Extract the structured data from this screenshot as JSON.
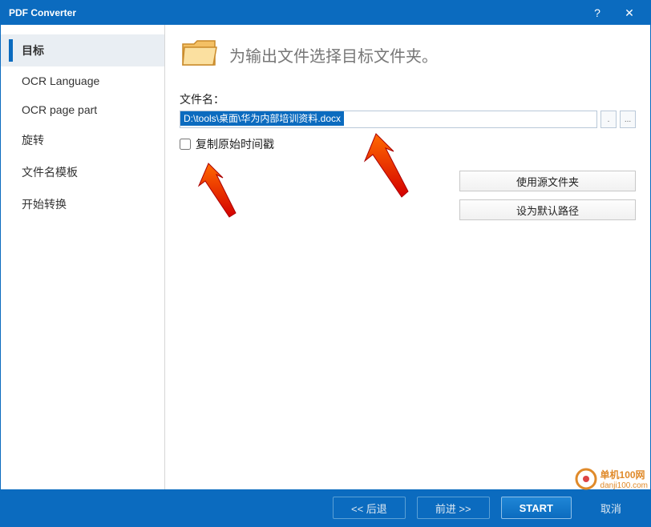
{
  "window": {
    "title": "PDF Converter"
  },
  "sidebar": {
    "items": [
      {
        "label": "目标"
      },
      {
        "label": "OCR Language"
      },
      {
        "label": "OCR page part"
      },
      {
        "label": "旋转"
      },
      {
        "label": "文件名模板"
      },
      {
        "label": "开始转换"
      }
    ]
  },
  "main": {
    "heading": "为输出文件选择目标文件夹。",
    "filename_label": "文件名：",
    "path_value": "D:\\tools\\桌面\\华为内部培训资料.docx",
    "browse_dot": ".",
    "browse_ellipsis": "...",
    "copy_timestamp_label": "复制原始时间戳",
    "use_source_folder": "使用源文件夹",
    "set_default_path": "设为默认路径"
  },
  "footer": {
    "back": "<<  后退",
    "forward": "前进  >>",
    "start": "START",
    "cancel": "取消"
  },
  "watermark": {
    "line1": "单机100网",
    "line2": "danji100.com"
  }
}
